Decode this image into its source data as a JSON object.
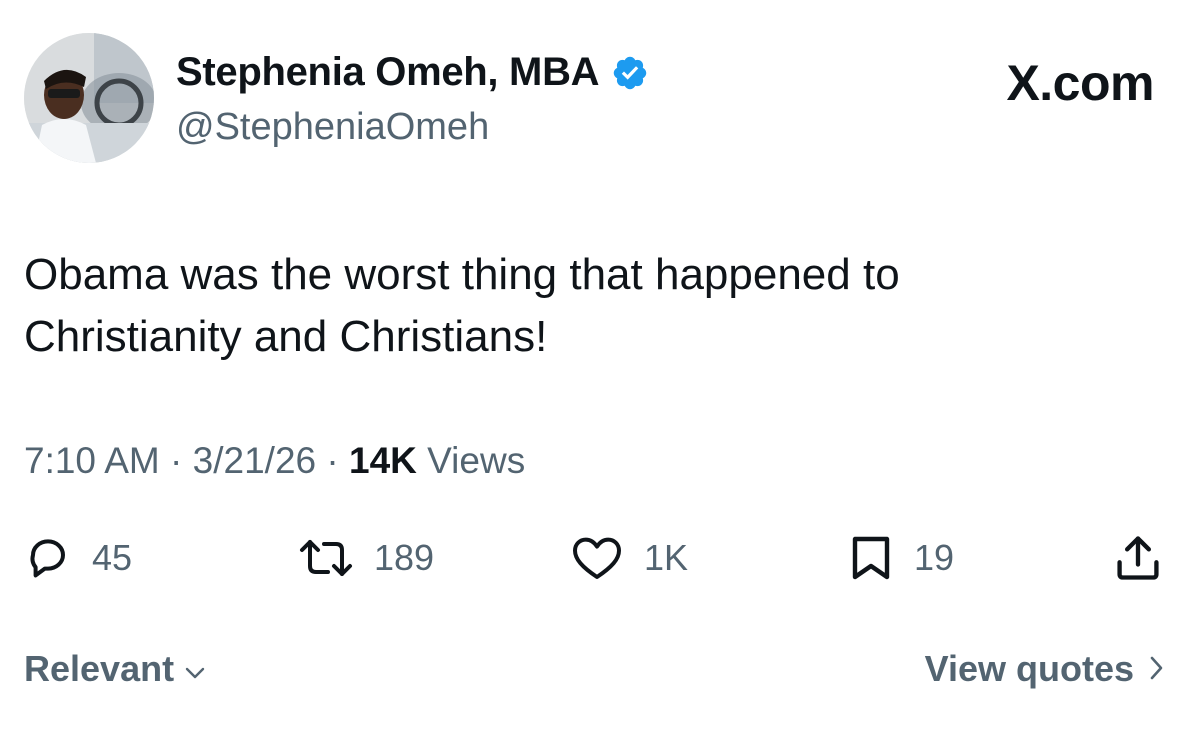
{
  "author": {
    "display_name": "Stephenia Omeh, MBA",
    "handle": "@StepheniaOmeh",
    "verified": true,
    "verified_color": "#1d9bf0"
  },
  "brand": {
    "text": "X.com"
  },
  "tweet": {
    "text_line1": "Obama was the worst thing that happened to",
    "text_line2": "Christianity and Christians!"
  },
  "meta": {
    "time": "7:10 AM",
    "sep1": " · ",
    "date": "3/21/26",
    "sep2": " · ",
    "views_count": "14K",
    "views_label": " Views"
  },
  "actions": {
    "replies": "45",
    "reposts": "189",
    "likes": "1K",
    "bookmarks": "19"
  },
  "footer": {
    "sort_label": "Relevant",
    "view_quotes_label": "View quotes"
  },
  "icons": {
    "reply": "reply-icon",
    "repost": "repost-icon",
    "like": "heart-icon",
    "bookmark": "bookmark-icon",
    "share": "share-icon",
    "verified": "verified-badge-icon",
    "sort": "chevron-down-icon",
    "quotes": "chevron-right-icon"
  },
  "colors": {
    "text_primary": "#0f1419",
    "text_secondary": "#536471",
    "verified": "#1d9bf0"
  }
}
